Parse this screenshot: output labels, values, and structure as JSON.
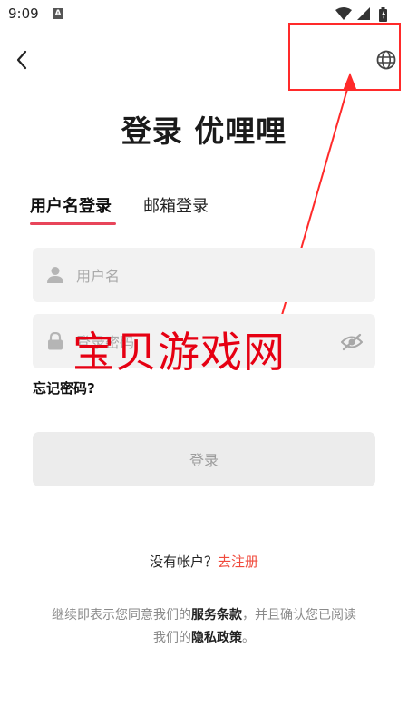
{
  "status_bar": {
    "time": "9:09",
    "notification_letter": "A",
    "icons": [
      "wifi-icon",
      "signal-icon",
      "battery-icon"
    ]
  },
  "header": {
    "back_icon": "chevron-left-icon",
    "language_icon": "globe-icon"
  },
  "title": "登录 优哩哩",
  "tabs": [
    {
      "label": "用户名登录",
      "active": true
    },
    {
      "label": "邮箱登录",
      "active": false
    }
  ],
  "form": {
    "username": {
      "value": "",
      "placeholder": "用户名",
      "icon": "user-icon"
    },
    "password": {
      "value": "",
      "placeholder": "登录密码",
      "icon": "lock-icon",
      "toggle_icon": "eye-off-icon"
    },
    "forgot_label": "忘记密码?",
    "submit_label": "登录"
  },
  "watermark": "宝贝游戏网",
  "signup": {
    "prompt": "没有帐户？",
    "link": "去注册"
  },
  "terms": {
    "line1_prefix": "继续即表示您同意我们的",
    "terms_link": "服务条款",
    "line1_suffix": "，并且确认您已阅读",
    "line2_prefix": "我们的",
    "privacy_link": "隐私政策",
    "line2_suffix": "。"
  },
  "colors": {
    "accent": "#e8455a",
    "link": "#f04a3c",
    "annotation": "#ff2a2a",
    "field_bg": "#f2f2f2"
  }
}
